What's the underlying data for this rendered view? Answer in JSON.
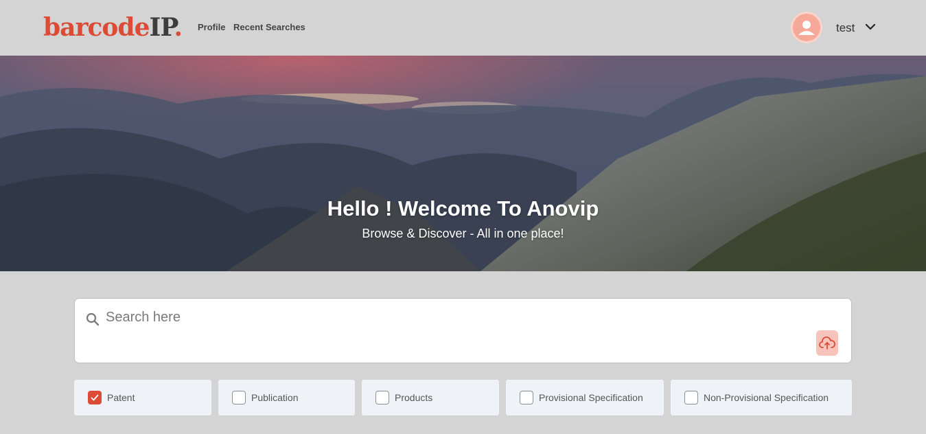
{
  "header": {
    "logo": {
      "part1": "barcode",
      "part2": "IP",
      "part3": "."
    },
    "nav": {
      "profile": "Profile",
      "recent_searches": "Recent Searches"
    },
    "user": {
      "name": "test",
      "avatar_icon": "user-silhouette-icon",
      "menu_icon": "chevron-down-icon"
    }
  },
  "hero": {
    "title": "Hello ! Welcome To Anovip",
    "subtitle": "Browse & Discover - All in one place!"
  },
  "search": {
    "placeholder": "Search here",
    "value": "",
    "search_icon": "search-icon",
    "upload_icon": "cloud-upload-icon"
  },
  "filters": [
    {
      "label": "Patent",
      "checked": true
    },
    {
      "label": "Publication",
      "checked": false
    },
    {
      "label": "Products",
      "checked": false
    },
    {
      "label": "Provisional Specification",
      "checked": false
    },
    {
      "label": "Non-Provisional Specification",
      "checked": false
    }
  ],
  "colors": {
    "accent": "#dc4b36",
    "background": "#d4d4d4",
    "filter_bg": "#eff2f7",
    "upload_bg": "#f7c4bb"
  }
}
